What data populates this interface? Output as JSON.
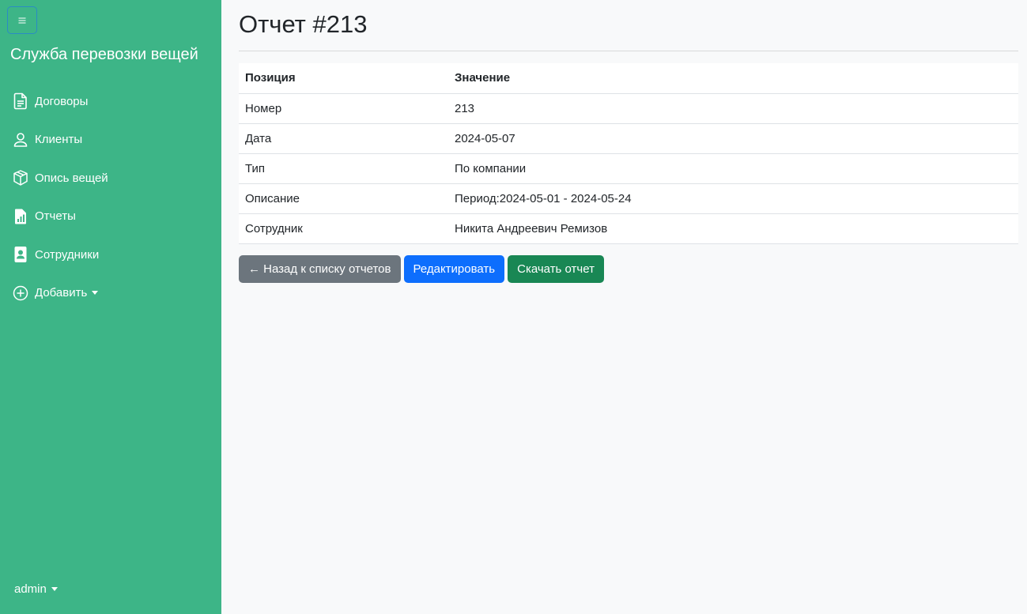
{
  "sidebar": {
    "brand": "Служба перевозки вещей",
    "items": [
      {
        "label": "Договоры",
        "icon": "document-icon"
      },
      {
        "label": "Клиенты",
        "icon": "person-icon"
      },
      {
        "label": "Опись вещей",
        "icon": "box-icon"
      },
      {
        "label": "Отчеты",
        "icon": "report-chart-icon"
      },
      {
        "label": "Сотрудники",
        "icon": "badge-icon"
      },
      {
        "label": "Добавить",
        "icon": "plus-circle-icon"
      }
    ],
    "user": "admin"
  },
  "main": {
    "title": "Отчет #213",
    "table": {
      "headers": [
        "Позиция",
        "Значение"
      ],
      "rows": [
        [
          "Номер",
          "213"
        ],
        [
          "Дата",
          "2024-05-07"
        ],
        [
          "Тип",
          "По компании"
        ],
        [
          "Описание",
          "Период:2024-05-01 - 2024-05-24"
        ],
        [
          "Сотрудник",
          "Никита Андреевич Ремизов"
        ]
      ]
    },
    "buttons": {
      "back": "← Назад к списку отчетов",
      "edit": "Редактировать",
      "download": "Скачать отчет"
    }
  },
  "colors": {
    "sidebar_bg": "#3db587",
    "primary": "#0d6efd",
    "secondary": "#6c757d",
    "success": "#198754"
  }
}
